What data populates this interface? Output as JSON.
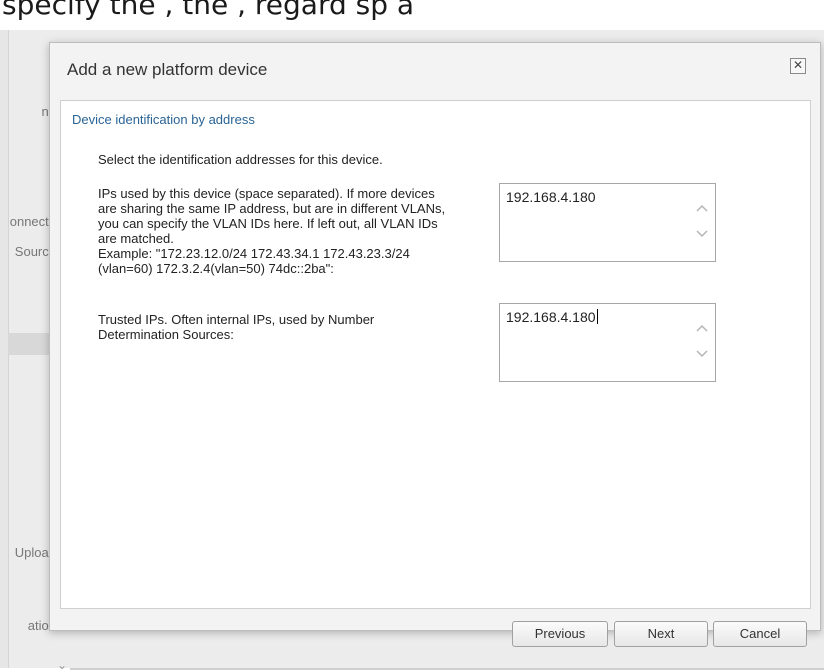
{
  "overlay": {
    "caption_fragment": "specify the ,   the   ,   regard sp  a"
  },
  "background": {
    "sidebar": [
      {
        "label": "ne"
      },
      {
        "label": "onnecte"
      },
      {
        "label": "Source"
      },
      {
        "label": "Upload"
      },
      {
        "label": "ation"
      }
    ]
  },
  "dialog": {
    "title": "Add a new platform device",
    "close_label": "✕",
    "section_title": "Device identification by address",
    "intro": "Select the identification addresses for this device.",
    "ips_field": {
      "label_lines": [
        "IPs used by this device (space separated). If more devices",
        "are sharing the same IP address, but are in different VLANs,",
        "you can specify the VLAN IDs here. If left out, all VLAN IDs",
        "are matched.",
        "Example: \"172.23.12.0/24 172.43.34.1 172.43.23.3/24",
        "(vlan=60) 172.3.2.4(vlan=50) 74dc::2ba\":"
      ],
      "value": "192.168.4.180"
    },
    "trusted_field": {
      "label_lines": [
        "Trusted IPs. Often internal IPs, used by Number",
        "Determination Sources:"
      ],
      "value": "192.168.4.180"
    },
    "buttons": {
      "previous": "Previous",
      "next": "Next",
      "cancel": "Cancel"
    }
  }
}
